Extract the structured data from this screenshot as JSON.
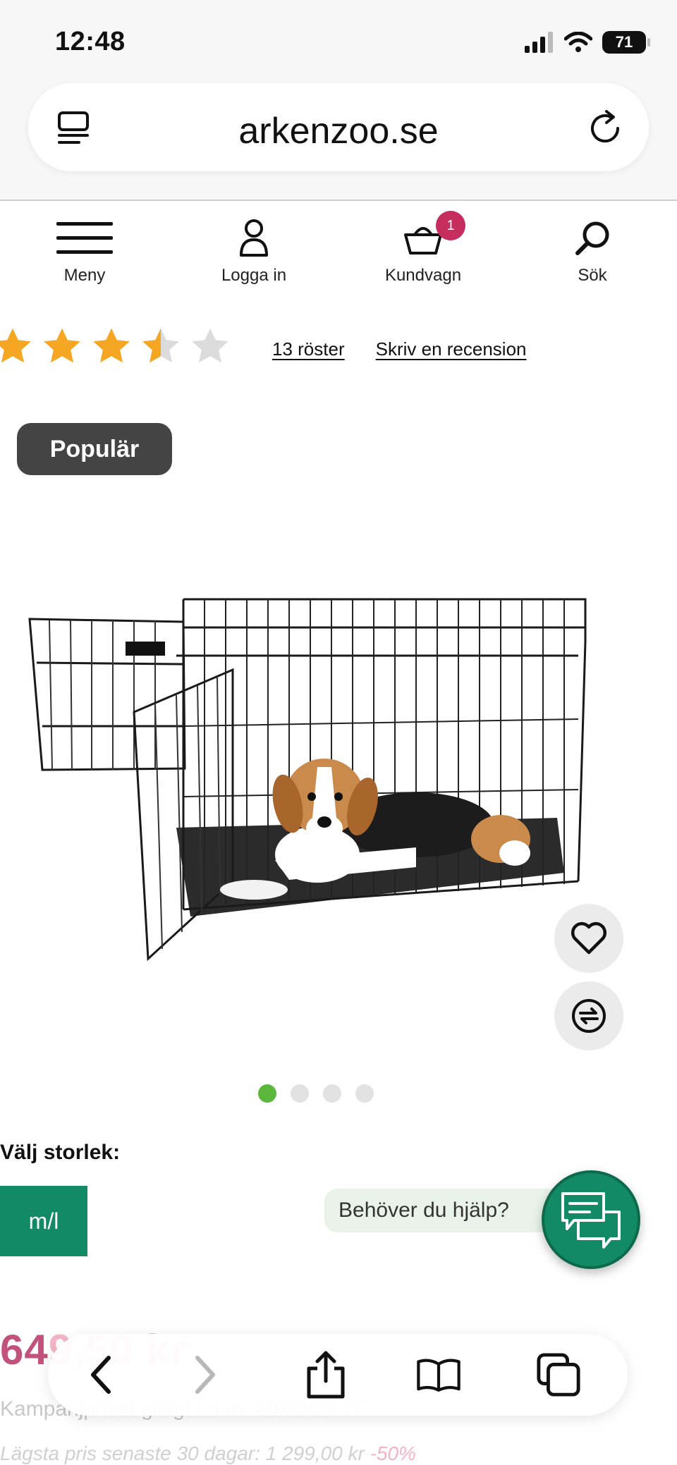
{
  "status": {
    "time": "12:48",
    "battery": "71"
  },
  "browser": {
    "url": "arkenzoo.se"
  },
  "nav": {
    "menu": "Meny",
    "login": "Logga in",
    "cart": "Kundvagn",
    "cart_count": "1",
    "search": "Sök"
  },
  "rating": {
    "stars": 3.5,
    "max": 5,
    "votes": "13 röster",
    "write_review": "Skriv en recension"
  },
  "product": {
    "badge": "Populär",
    "gallery_index": 1,
    "gallery_count": 4
  },
  "size": {
    "label": "Välj storlek:",
    "selected": "m/l"
  },
  "help": {
    "text": "Behöver du hjälp?"
  },
  "price": {
    "visible_prefix": "64",
    "faded_part": "9,50 kr",
    "campaign_text": "Kampanjpriset giltigt t.o.m. 2023-05-17",
    "lowest_text": "Lägsta pris senaste 30 dagar: 1 299,00 kr",
    "discount": "-50%"
  },
  "colors": {
    "brand_green": "#128a63",
    "badge_pink": "#c42d5e",
    "star_orange": "#f5a623",
    "dot_active": "#5cb83c"
  }
}
